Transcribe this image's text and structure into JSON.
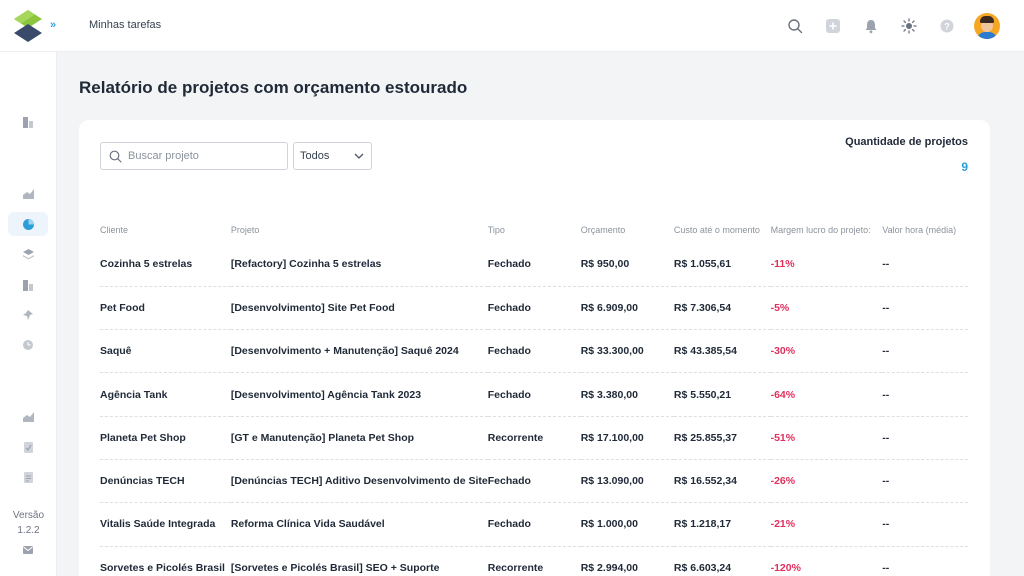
{
  "header": {
    "breadcrumb": "Minhas tarefas",
    "expand_icon": "double-chevron-right-icon",
    "icons": [
      "search-icon",
      "add-icon",
      "bell-icon",
      "sun-icon",
      "help-icon"
    ]
  },
  "sidebar": {
    "icons": [
      "report-icon",
      "chart-up-icon",
      "pie-chart-icon",
      "layers-icon",
      "report-icon",
      "pin-icon",
      "clock-icon",
      "chart-up-icon",
      "checklist-icon",
      "document-icon",
      "mail-icon"
    ],
    "version_label": "Versão",
    "version_number": "1.2.2"
  },
  "page": {
    "title": "Relatório de projetos com orçamento estourado"
  },
  "filters": {
    "search_placeholder": "Buscar projeto",
    "type_selected": "Todos"
  },
  "summary": {
    "label": "Quantidade de projetos",
    "value": "9"
  },
  "table": {
    "headers": [
      "Cliente",
      "Projeto",
      "Tipo",
      "Orçamento",
      "Custo até o momento",
      "Margem lucro do projeto:",
      "Valor hora (média)"
    ],
    "rows": [
      [
        "Cozinha 5 estrelas",
        "[Refactory] Cozinha 5 estrelas",
        "Fechado",
        "R$ 950,00",
        "R$ 1.055,61",
        "-11%",
        "--"
      ],
      [
        "Pet Food",
        "[Desenvolvimento] Site Pet Food",
        "Fechado",
        "R$ 6.909,00",
        "R$ 7.306,54",
        "-5%",
        "--"
      ],
      [
        "Saquê",
        "[Desenvolvimento + Manutenção] Saquê 2024",
        "Fechado",
        "R$ 33.300,00",
        "R$ 43.385,54",
        "-30%",
        "--"
      ],
      [
        "Agência Tank",
        "[Desenvolvimento] Agência Tank 2023",
        "Fechado",
        "R$ 3.380,00",
        "R$ 5.550,21",
        "-64%",
        "--"
      ],
      [
        "Planeta Pet Shop",
        "[GT e Manutenção] Planeta Pet Shop",
        "Recorrente",
        "R$ 17.100,00",
        "R$ 25.855,37",
        "-51%",
        "--"
      ],
      [
        "Denúncias TECH",
        "[Denúncias TECH] Aditivo Desenvolvimento de Site",
        "Fechado",
        "R$ 13.090,00",
        "R$ 16.552,34",
        "-26%",
        "--"
      ],
      [
        "Vitalis Saúde Integrada",
        "Reforma Clínica Vida Saudável",
        "Fechado",
        "R$ 1.000,00",
        "R$ 1.218,17",
        "-21%",
        "--"
      ],
      [
        "Sorvetes e Picolés Brasil",
        "[Sorvetes e Picolés Brasil] SEO + Suporte",
        "Recorrente",
        "R$ 2.994,00",
        "R$ 6.603,24",
        "-120%",
        "--"
      ]
    ]
  },
  "colors": {
    "accent": "#2b9ed8",
    "negative": "#e0305e",
    "logo_green": "#8cc63f",
    "logo_navy": "#3a4a6b"
  }
}
